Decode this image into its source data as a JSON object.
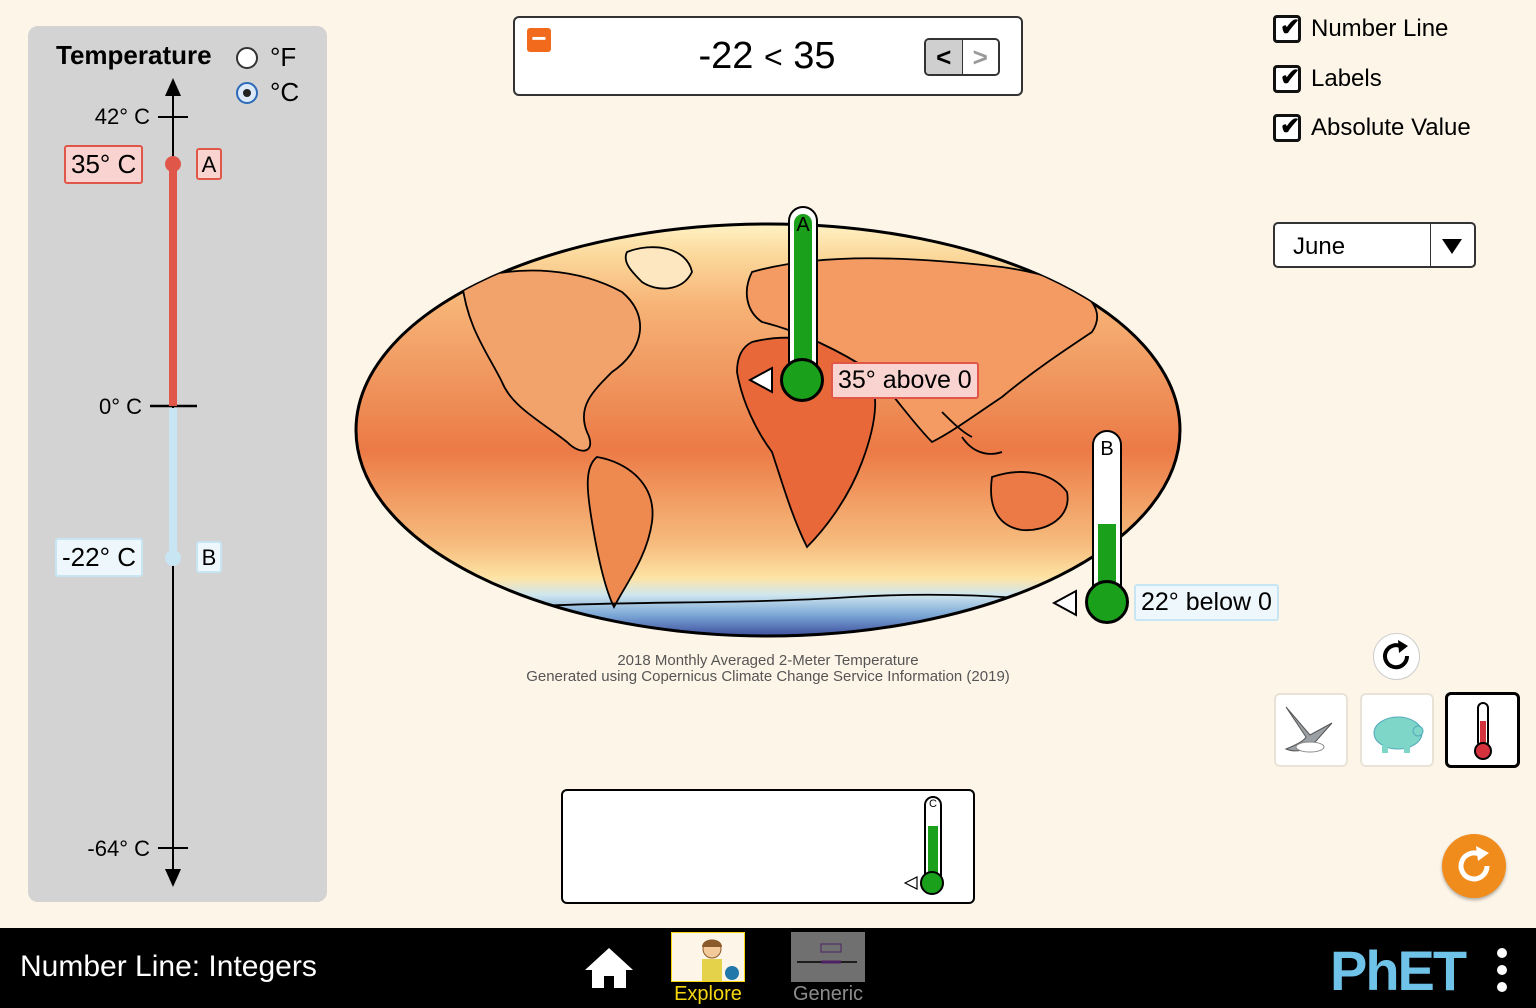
{
  "panel": {
    "title": "Temperature",
    "units": [
      {
        "label": "°F",
        "selected": false
      },
      {
        "label": "°C",
        "selected": true
      }
    ],
    "ticks": [
      "42° C",
      "0° C",
      "-64° C"
    ],
    "point_a": {
      "value": "35° C",
      "letter": "A",
      "celsius": 35
    },
    "point_b": {
      "value": "-22° C",
      "letter": "B",
      "celsius": -22
    }
  },
  "comparison": {
    "left": "-22",
    "op": "<",
    "right": "35",
    "minimize_symbol": "−",
    "btn_lt": "<",
    "btn_gt": ">"
  },
  "options": {
    "number_line": "Number Line",
    "labels": "Labels",
    "absolute_value": "Absolute Value"
  },
  "month": "June",
  "map": {
    "caption_line1": "2018 Monthly Averaged 2-Meter Temperature",
    "caption_line2": "Generated using Copernicus Climate Change Service Information (2019)"
  },
  "thermometers": {
    "a": {
      "letter": "A",
      "label": "35° above 0",
      "level": 1.0
    },
    "b": {
      "letter": "B",
      "label": "22° below 0",
      "level": 0.55
    },
    "c": {
      "letter": "C",
      "level": 0.7
    }
  },
  "navbar": {
    "sim_title": "Number Line: Integers",
    "screens": [
      {
        "label": "Explore",
        "active": true
      },
      {
        "label": "Generic",
        "active": false
      }
    ],
    "brand": "PhET"
  },
  "colors": {
    "positive_red": "#e0574a",
    "negative_blue": "#c7e5f3",
    "thermo_green": "#1aa01a",
    "active_tab": "#f7d80f",
    "reset_orange": "#f08c1c"
  }
}
